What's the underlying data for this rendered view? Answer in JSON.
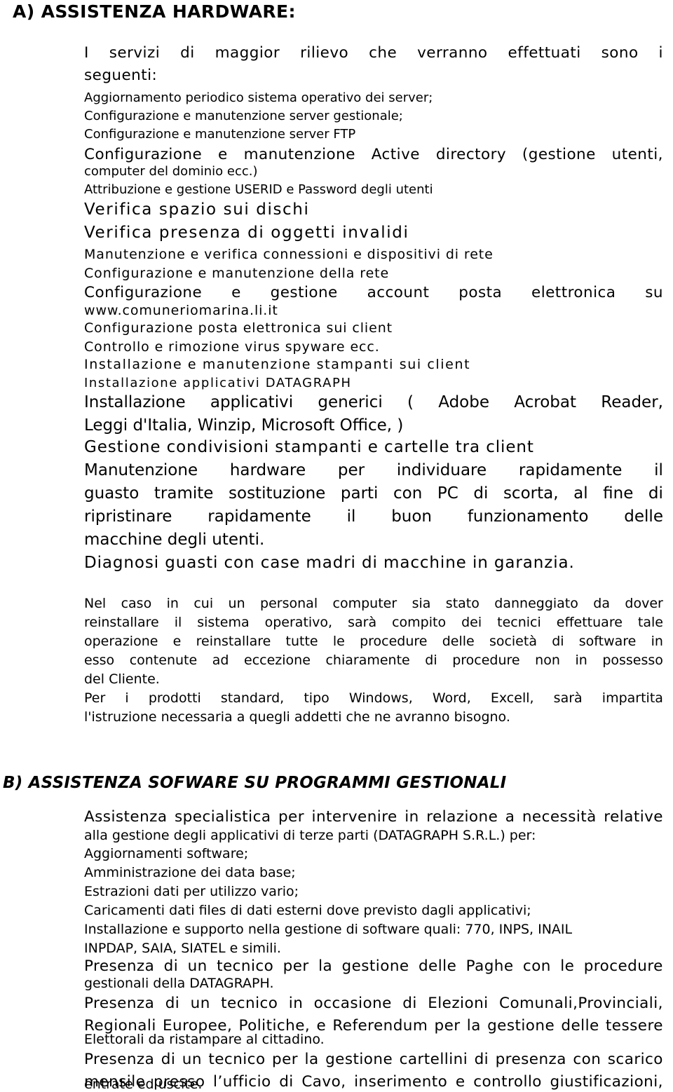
{
  "document": {
    "sections": [
      {
        "id": "a",
        "heading": "A) ASSISTENZA HARDWARE:",
        "intro": {
          "line1_words": [
            "I",
            "servizi",
            "di",
            "maggior",
            "rilievo",
            "che",
            "verranno",
            "effettuati",
            "sono",
            "i"
          ],
          "line2": "seguenti:"
        },
        "items": [
          "Aggiornamento periodico sistema operativo dei server;",
          "Configurazione e manutenzione server gestionale;",
          "Configurazione e manutenzione server FTP",
          "Configurazione e manutenzione Active directory (gestione utenti,",
          "computer del dominio ecc.)",
          "Attribuzione e gestione USERID e Password degli utenti",
          "Verifica spazio sui  dischi",
          "Verifica presenza di oggetti invalidi",
          "Manutenzione e verifica connessioni e dispositivi di rete",
          "Configurazione e manutenzione della rete",
          "www.comuneriomarina.li.it",
          "Configurazione posta elettronica sui client",
          "Controllo e rimozione virus spyware ecc.",
          "Installazione e manutenzione stampanti sui client",
          "Installazione applicativi DATAGRAPH",
          "Leggi d'Italia, Winzip, Microsoft Office, )",
          "Gestione condivisioni stampanti e cartelle tra client",
          "macchine degli utenti.",
          "Diagnosi guasti con case madri di macchine in garanzia."
        ],
        "justified": {
          "active_directory_words": [
            "Configurazione",
            "e",
            "manutenzione",
            "Active",
            "directory",
            "(gestione",
            "utenti,"
          ],
          "account_posta_words": [
            "Configurazione",
            "e",
            "gestione",
            "account",
            "posta",
            "elettronica",
            "su"
          ],
          "applicativi_generici_words": [
            "Installazione",
            "applicativi",
            "generici",
            "(",
            "Adobe",
            "Acrobat",
            "Reader,"
          ],
          "manutenzione_hw_words": [
            "Manutenzione",
            "hardware",
            "per",
            "individuare",
            "rapidamente",
            "il"
          ],
          "guasto_words": [
            "guasto",
            "tramite",
            "sostituzione",
            "parti",
            "con",
            "PC",
            "di",
            "scorta,",
            "al",
            "fine",
            "di"
          ],
          "ripristinare_words": [
            "ripristinare",
            "rapidamente",
            "il",
            "buon",
            "funzionamento",
            "delle"
          ]
        },
        "paragraph": {
          "l1_words": [
            "Nel",
            "caso",
            "in",
            "cui",
            "un",
            "personal",
            "computer",
            "sia",
            "stato",
            "danneggiato",
            "da",
            "dover"
          ],
          "l2_words": [
            "reinstallare",
            "il",
            "sistema",
            "operativo,",
            "sarà",
            "compito",
            "dei",
            "tecnici",
            "effettuare",
            "tale"
          ],
          "l3_words": [
            "operazione",
            "e",
            "reinstallare",
            "tutte",
            "le",
            "procedure",
            "delle",
            "società",
            "di",
            "software",
            "in"
          ],
          "l4_words": [
            "esso",
            "contenute",
            "ad",
            "eccezione",
            "chiaramente",
            "di",
            "procedure",
            "non",
            "in",
            "possesso"
          ],
          "l5": "del Cliente.",
          "l6_words": [
            "Per",
            "i",
            "prodotti",
            "standard,",
            "tipo",
            "Windows,",
            "Word,",
            "Excell,",
            "sarà",
            "impartita"
          ],
          "l7": "l'istruzione necessaria a quegli addetti che ne avranno bisogno."
        }
      },
      {
        "id": "b",
        "heading": "B) ASSISTENZA SOFWARE SU PROGRAMMI GESTIONALI",
        "intro": {
          "l1_words": [
            "Assistenza",
            "specialistica",
            "per",
            "intervenire",
            "in",
            "relazione",
            "a",
            "necessità",
            "relative"
          ],
          "l2": "alla gestione degli applicativi di terze parti (DATAGRAPH S.R.L.) per:"
        },
        "items": [
          "Aggiornamenti software;",
          "Amministrazione dei data base;",
          "Estrazioni dati per utilizzo vario;",
          "Caricamenti dati files di dati esterni dove previsto dagli applicativi;",
          "Installazione e supporto nella gestione di software quali: 770, INPS, INAIL",
          "INPDAP, SAIA, SIATEL  e simili.",
          "gestionali della DATAGRAPH.",
          "Elettorali da ristampare al cittadino.",
          "entrate ed uscite."
        ],
        "justified": {
          "paghe_words": [
            "Presenza",
            "di",
            "un",
            "tecnico",
            "per",
            "la",
            "gestione",
            "delle",
            "Paghe",
            "con",
            "le",
            "procedure"
          ],
          "elezioni_words": [
            "Presenza",
            "di",
            "un",
            "tecnico",
            "in",
            "occasione",
            "di",
            "Elezioni",
            "Comunali,Provinciali,"
          ],
          "regionali_words": [
            "Regionali",
            "Europee,",
            "Politiche,",
            "e",
            "Referendum",
            "per",
            "la",
            "gestione",
            "delle",
            "tessere"
          ],
          "cartellini_words": [
            "Presenza",
            "di",
            "un",
            "tecnico",
            "per",
            "la",
            "gestione",
            "cartellini",
            "di",
            "presenza",
            "con",
            "scarico"
          ],
          "mensile_words": [
            "mensile",
            "presso",
            "l’ufficio",
            "di",
            "Cavo,",
            "inserimento",
            "e",
            "controllo",
            "giustificazioni,"
          ]
        }
      }
    ]
  }
}
